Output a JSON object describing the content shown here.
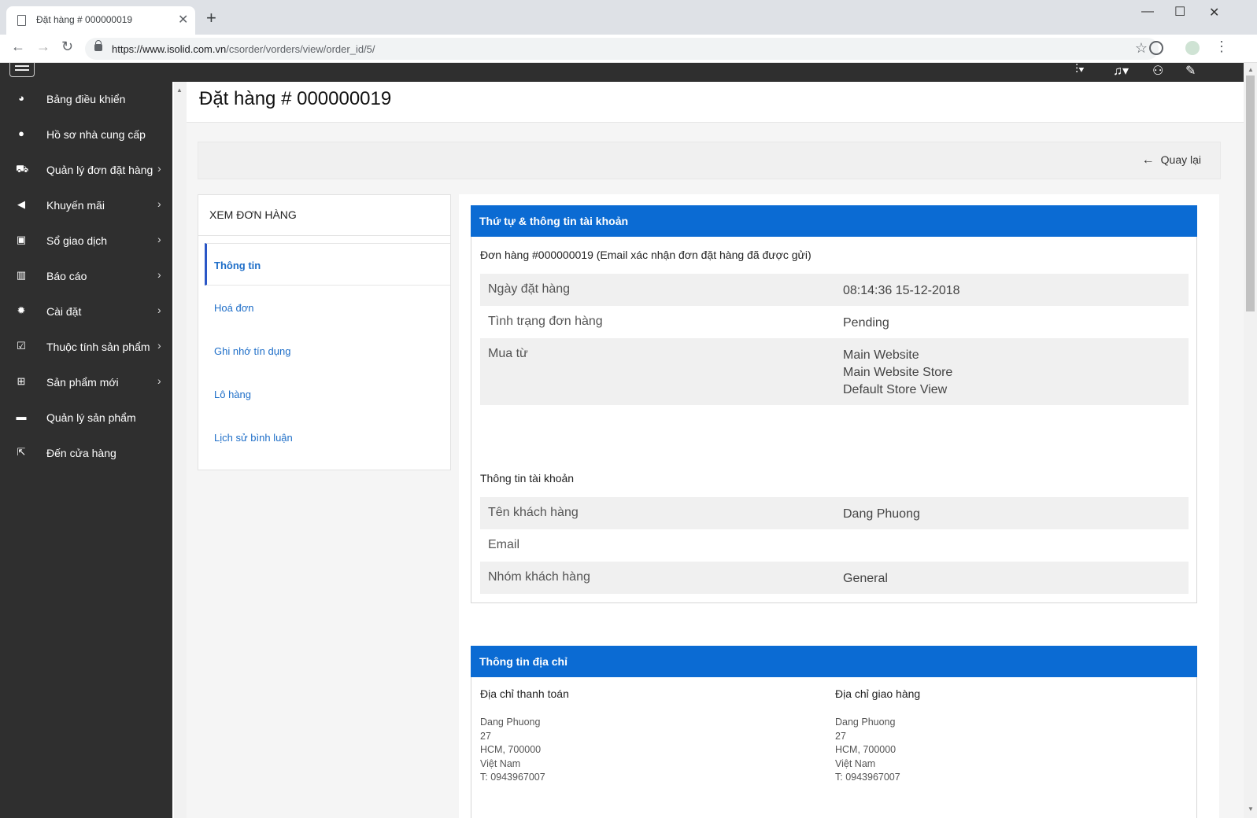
{
  "browser": {
    "tab_title": "Đặt hàng # 000000019",
    "url_domain": "https://www.isolid.com.vn",
    "url_path": "/csorder/vorders/view/order_id/5/"
  },
  "sidebar": {
    "items": [
      {
        "label": "Bảng điều khiển",
        "icon": "dashboard-icon",
        "chevron": false
      },
      {
        "label": "Hồ sơ nhà cung cấp",
        "icon": "user-icon",
        "chevron": false
      },
      {
        "label": "Quản lý đơn đặt hàng",
        "icon": "cart-icon",
        "chevron": true
      },
      {
        "label": "Khuyến mãi",
        "icon": "megaphone-icon",
        "chevron": true
      },
      {
        "label": "Sổ giao dịch",
        "icon": "money-icon",
        "chevron": true
      },
      {
        "label": "Báo cáo",
        "icon": "bar-chart-icon",
        "chevron": true
      },
      {
        "label": "Cài đặt",
        "icon": "gear-icon",
        "chevron": true
      },
      {
        "label": "Thuộc tính sản phẩm",
        "icon": "checkbox-icon",
        "chevron": true
      },
      {
        "label": "Sản phẩm mới",
        "icon": "plus-square-icon",
        "chevron": true
      },
      {
        "label": "Quản lý sản phẩm",
        "icon": "folder-icon",
        "chevron": false
      },
      {
        "label": "Đến cửa hàng",
        "icon": "external-link-icon",
        "chevron": false
      }
    ]
  },
  "page": {
    "title": "Đặt hàng # 000000019",
    "back_label": "Quay lại"
  },
  "left_panel": {
    "title": "XEM ĐƠN HÀNG",
    "items": [
      "Thông tin",
      "Hoá đơn",
      "Ghi nhớ tín dụng",
      "Lô hàng",
      "Lịch sử bình luận"
    ],
    "active_index": 0
  },
  "order_info": {
    "header": "Thứ tự & thông tin tài khoản",
    "subtitle": "Đơn hàng #000000019 (Email xác nhận đơn đặt hàng đã được gửi)",
    "rows": [
      {
        "label": "Ngày đặt hàng",
        "value": "08:14:36 15-12-2018"
      },
      {
        "label": "Tình trạng đơn hàng",
        "value": "Pending"
      },
      {
        "label": "Mua từ",
        "value_lines": [
          "Main Website",
          "Main Website Store",
          "Default Store View"
        ]
      }
    ],
    "account_subtitle": "Thông tin tài khoản",
    "account_rows": [
      {
        "label": "Tên khách hàng",
        "value": "Dang Phuong"
      },
      {
        "label": "Email",
        "value": ""
      },
      {
        "label": "Nhóm khách hàng",
        "value": "General"
      }
    ]
  },
  "address_info": {
    "header": "Thông tin địa chỉ",
    "billing_title": "Địa chỉ thanh toán",
    "billing_lines": [
      "Dang Phuong",
      "27",
      "HCM, 700000",
      "Việt Nam",
      "T: 0943967007"
    ],
    "shipping_title": "Địa chỉ giao hàng",
    "shipping_lines": [
      "Dang Phuong",
      "27",
      "HCM, 700000",
      "Việt Nam",
      "T: 0943967007"
    ]
  }
}
